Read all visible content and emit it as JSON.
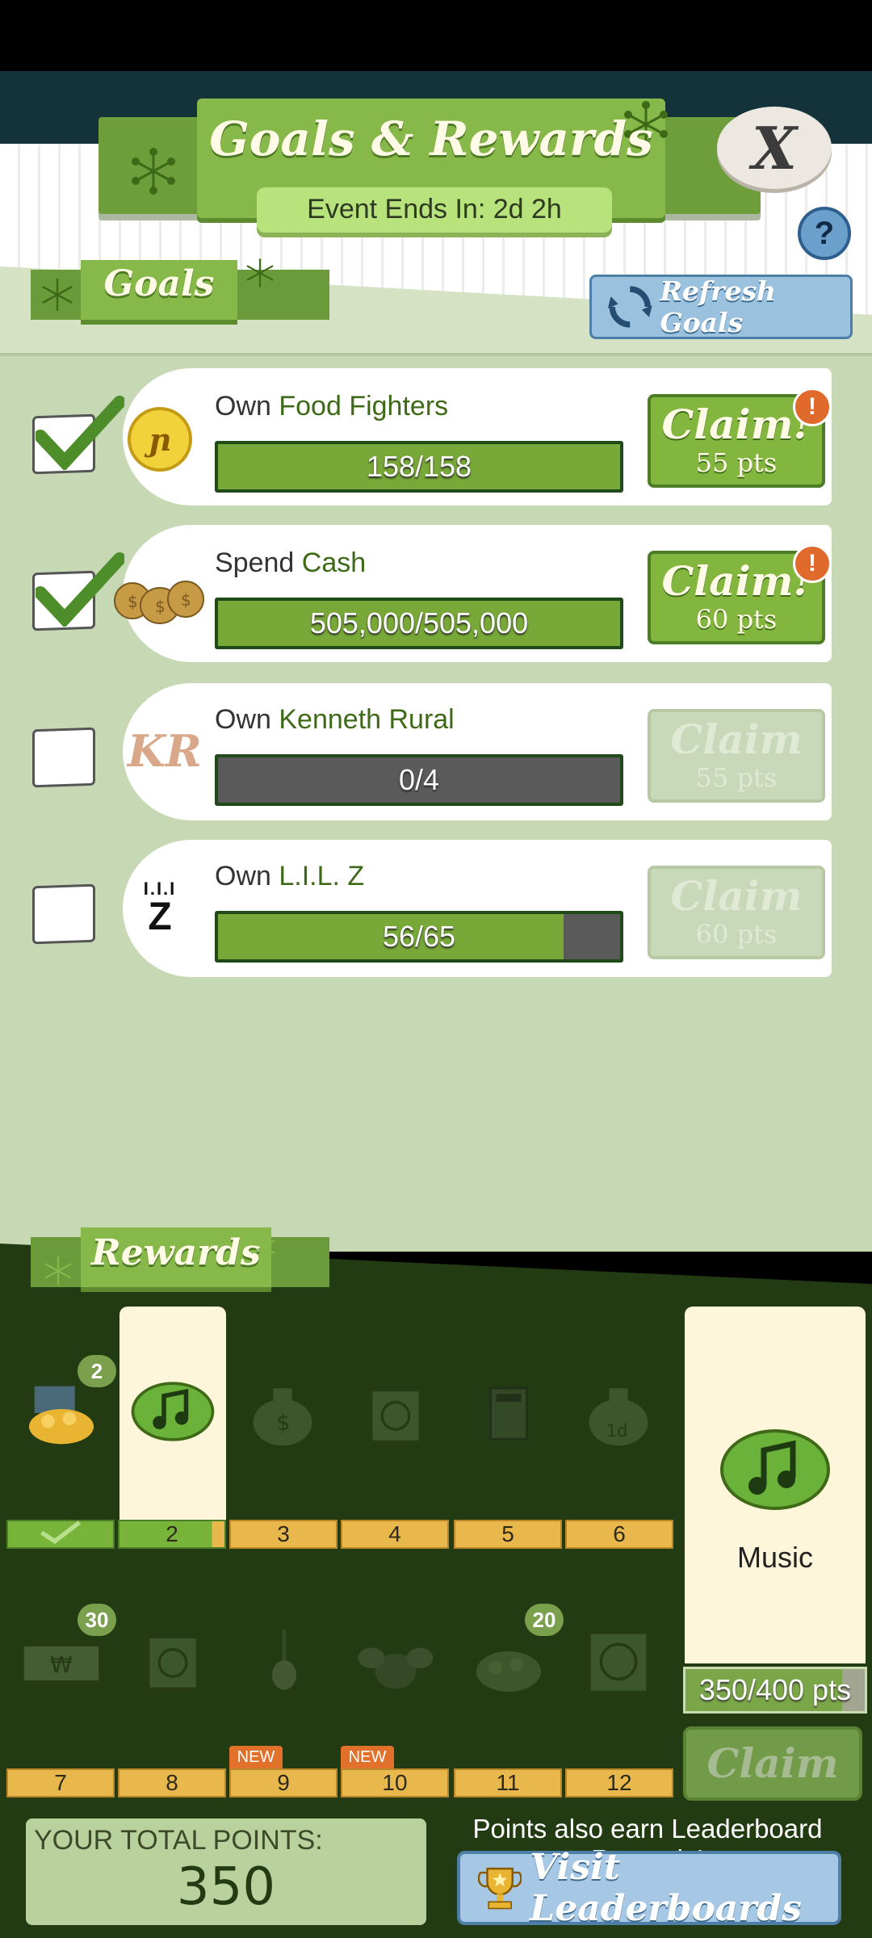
{
  "header": {
    "title": "Goals & Rewards",
    "event_timer": "Event Ends In: 2d 2h",
    "close_label": "X",
    "help_label": "?"
  },
  "goals_section": {
    "title": "Goals",
    "refresh_label": "Refresh Goals",
    "items": [
      {
        "prefix": "Own",
        "subject": "Food Fighters",
        "progress_text": "158/158",
        "progress_fraction": 1.0,
        "completed": true,
        "claim_title": "Claim!",
        "claim_pts": "55 pts",
        "alert": "!",
        "icon": "coin-emblem-icon"
      },
      {
        "prefix": "Spend",
        "subject": "Cash",
        "progress_text": "505,000/505,000",
        "progress_fraction": 1.0,
        "completed": true,
        "claim_title": "Claim!",
        "claim_pts": "60 pts",
        "alert": "!",
        "icon": "money-bags-icon"
      },
      {
        "prefix": "Own",
        "subject": "Kenneth Rural",
        "progress_text": "0/4",
        "progress_fraction": 0.0,
        "completed": false,
        "claim_title": "Claim",
        "claim_pts": "55 pts",
        "icon": "kr-logo-icon",
        "icon_text": "KR"
      },
      {
        "prefix": "Own",
        "subject": "L.I.L. Z",
        "progress_text": "56/65",
        "progress_fraction": 0.86,
        "completed": false,
        "claim_title": "Claim",
        "claim_pts": "60 pts",
        "icon": "lilz-logo-icon",
        "icon_text": "Z"
      }
    ]
  },
  "rewards_section": {
    "title": "Rewards",
    "row1": [
      {
        "level": "",
        "icon": "gold-pile-icon",
        "count": "2",
        "status": "done"
      },
      {
        "level": "2",
        "icon": "music-note-icon",
        "status": "current"
      },
      {
        "level": "3",
        "icon": "cash-bag-icon",
        "status": "locked"
      },
      {
        "level": "4",
        "icon": "crate-icon",
        "status": "locked"
      },
      {
        "level": "5",
        "icon": "amp-icon",
        "status": "locked"
      },
      {
        "level": "6",
        "icon": "cash-bag-timer-icon",
        "status": "locked"
      }
    ],
    "row2": [
      {
        "level": "7",
        "icon": "banknote-icon",
        "count": "30",
        "status": "locked"
      },
      {
        "level": "8",
        "icon": "crate-icon",
        "status": "locked"
      },
      {
        "level": "9",
        "icon": "guitar-icon",
        "badge": "NEW",
        "status": "locked"
      },
      {
        "level": "10",
        "icon": "drum-kit-icon",
        "badge": "NEW",
        "status": "locked"
      },
      {
        "level": "11",
        "icon": "gold-pile-icon",
        "count": "20",
        "status": "locked"
      },
      {
        "level": "12",
        "icon": "crate-large-icon",
        "status": "locked"
      }
    ],
    "featured": {
      "label": "Music",
      "points_text": "350/400 pts",
      "points_fraction": 0.875,
      "claim_label": "Claim"
    }
  },
  "footer": {
    "total_label": "YOUR TOTAL POINTS:",
    "total_value": "350",
    "leaderboard_note": "Points also earn Leaderboard Rewards!",
    "leaderboard_button": "Visit Leaderboards"
  },
  "colors": {
    "accent_green": "#86b84a",
    "dark_green": "#233b12",
    "alert_orange": "#e06a2b",
    "button_blue": "#9ac1dd"
  }
}
